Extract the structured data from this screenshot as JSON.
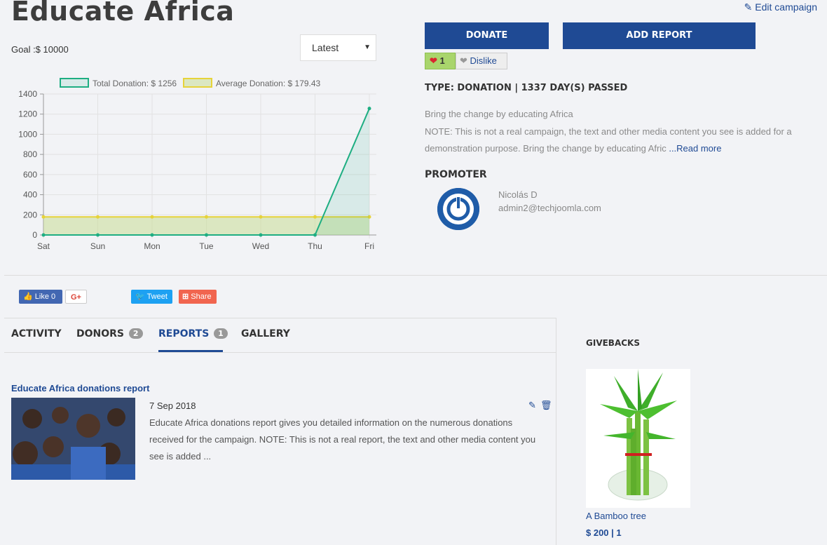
{
  "campaign": {
    "title": "Educate Africa",
    "goal": "Goal :$ 10000",
    "edit_label": "Edit campaign",
    "donate_label": "DONATE",
    "add_report_label": "ADD REPORT",
    "like_count": "1",
    "dislike_label": "Dislike",
    "type_line": "TYPE: DONATION | 1337 DAY(S) PASSED",
    "description_line1": "Bring the change by educating Africa",
    "description_line2": "NOTE: This is not a real campaign, the text and other media content you see is added for a demonstration purpose. Bring the change by educating Afric ",
    "read_more": "...Read more"
  },
  "sort": {
    "selected": "Latest"
  },
  "promoter": {
    "heading": "PROMOTER",
    "name": "Nicolás D",
    "email": "admin2@techjoomla.com"
  },
  "social": {
    "fb_like": "Like 0",
    "gplus": "G+",
    "tweet": "Tweet",
    "share": "Share"
  },
  "tabs": [
    {
      "label": "ACTIVITY"
    },
    {
      "label": "DONORS",
      "badge": "2"
    },
    {
      "label": "REPORTS",
      "badge": "1"
    },
    {
      "label": "GALLERY"
    }
  ],
  "report": {
    "title": "Educate Africa donations report",
    "date": "7 Sep 2018",
    "text": "Educate Africa donations report gives you detailed information on the numerous donations received for the campaign. NOTE: This is not a real report, the text and other media content you see is added ..."
  },
  "givebacks": {
    "heading": "GIVEBACKS",
    "item_name": "A Bamboo tree",
    "item_price": "$ 200 | 1"
  },
  "colors": {
    "brand_blue": "#1f4a94",
    "total_line": "#1eae82",
    "average_line": "#e6d33a"
  },
  "chart_data": {
    "type": "line",
    "categories": [
      "Sat",
      "Sun",
      "Mon",
      "Tue",
      "Wed",
      "Thu",
      "Fri"
    ],
    "series": [
      {
        "name": "Total Donation: $ 1256",
        "values": [
          0,
          0,
          0,
          0,
          0,
          0,
          1256
        ]
      },
      {
        "name": "Average Donation: $ 179.43",
        "values": [
          179.43,
          179.43,
          179.43,
          179.43,
          179.43,
          179.43,
          179.43
        ]
      }
    ],
    "yticks": [
      0,
      200,
      400,
      600,
      800,
      1000,
      1200,
      1400
    ],
    "ylim": [
      0,
      1400
    ],
    "legend": "top",
    "grid": true
  }
}
